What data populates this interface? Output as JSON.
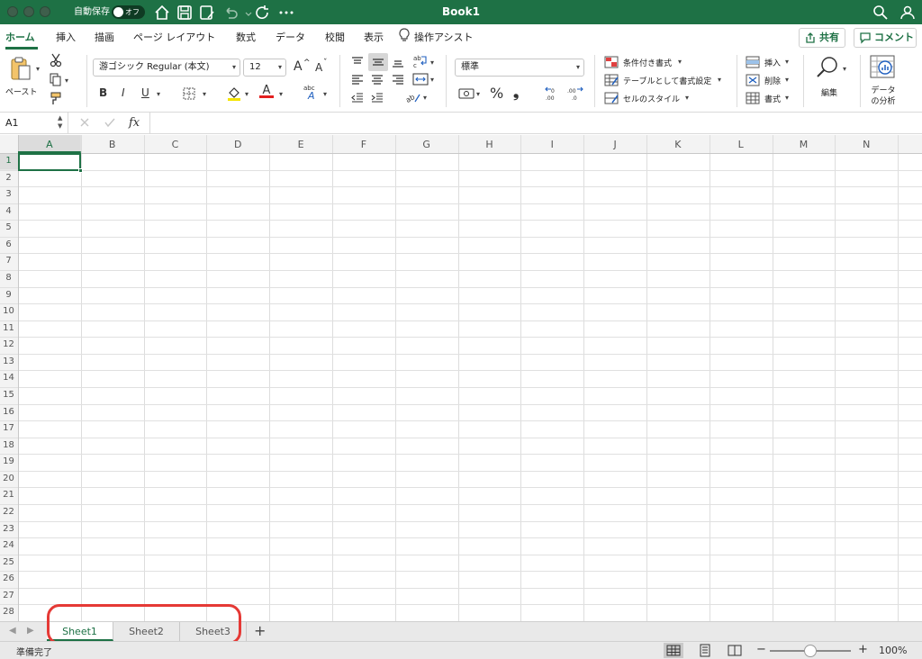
{
  "titlebar": {
    "autosave_label": "自動保存",
    "toggle_state": "オフ",
    "doc_title": "Book1",
    "color": "#1e7145"
  },
  "tabs": [
    "ホーム",
    "挿入",
    "描画",
    "ページ レイアウト",
    "数式",
    "データ",
    "校閲",
    "表示",
    "操作アシスト"
  ],
  "actions": {
    "share": "共有",
    "comment": "コメント"
  },
  "ribbon": {
    "paste_label": "ペースト",
    "font_name": "游ゴシック Regular (本文)",
    "font_size": "12",
    "grow_font": "A",
    "shrink_font": "A",
    "bold": "B",
    "italic": "I",
    "underline": "U",
    "number_format": "標準",
    "percent": "%",
    "comma": "❟",
    "conditional_format": "条件付き書式",
    "format_as_table": "テーブルとして書式設定",
    "cell_styles": "セルのスタイル",
    "insert": "挿入",
    "delete": "削除",
    "format": "書式",
    "edit": "編集",
    "analyze_line1": "データ",
    "analyze_line2": "の分析"
  },
  "formulabar": {
    "cell_ref": "A1",
    "fx": "fx",
    "value": ""
  },
  "grid": {
    "columns": [
      "A",
      "B",
      "C",
      "D",
      "E",
      "F",
      "G",
      "H",
      "I",
      "J",
      "K",
      "L",
      "M",
      "N"
    ],
    "rows": [
      "1",
      "2",
      "3",
      "4",
      "5",
      "6",
      "7",
      "8",
      "9",
      "10",
      "11",
      "12",
      "13",
      "14",
      "15",
      "16",
      "17",
      "18",
      "19",
      "20",
      "21",
      "22",
      "23",
      "24",
      "25",
      "26",
      "27",
      "28"
    ],
    "selected_cell": "A1"
  },
  "sheets": [
    "Sheet1",
    "Sheet2",
    "Sheet3"
  ],
  "active_sheet": "Sheet1",
  "add_sheet": "+",
  "status": {
    "text": "準備完了",
    "zoom": "100%",
    "zoom_minus": "−",
    "zoom_plus": "+"
  }
}
